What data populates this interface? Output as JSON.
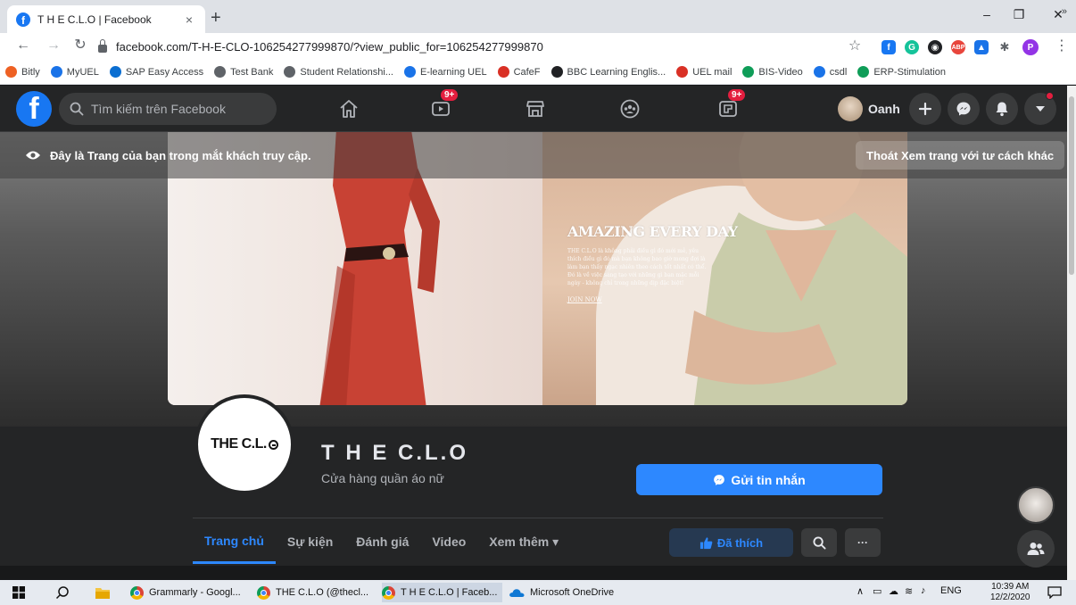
{
  "browser": {
    "tab_title": "T H E C.L.O | Facebook",
    "tab_close": "×",
    "new_tab": "+",
    "url": "facebook.com/T-H-E-CLO-106254277999870/?view_public_for=106254277999870",
    "bookmarks": [
      {
        "label": "Bitly",
        "color": "#ee6123"
      },
      {
        "label": "MyUEL",
        "color": "#1a73e8"
      },
      {
        "label": "SAP Easy Access",
        "color": "#0a6ed1"
      },
      {
        "label": "Test Bank",
        "color": "#5f6368"
      },
      {
        "label": "Student Relationshi...",
        "color": "#5f6368"
      },
      {
        "label": "E-learning UEL",
        "color": "#1a73e8"
      },
      {
        "label": "CafeF",
        "color": "#d93025"
      },
      {
        "label": "BBC Learning Englis...",
        "color": "#202124"
      },
      {
        "label": "UEL mail",
        "color": "#d93025"
      },
      {
        "label": "BIS-Video",
        "color": "#0f9d58"
      },
      {
        "label": "csdl",
        "color": "#1a73e8"
      },
      {
        "label": "ERP-Stimulation",
        "color": "#0f9d58"
      }
    ],
    "bookmarks_more": "»",
    "profile_letter": "P"
  },
  "fb": {
    "logo": "f",
    "search_placeholder": "Tìm kiếm trên Facebook",
    "watch_badge": "9+",
    "gaming_badge": "9+",
    "user_name": "Oanh"
  },
  "banner": {
    "text": "Đây là Trang của bạn trong mắt khách truy cập.",
    "exit_button": "Thoát Xem trang với tư cách khác"
  },
  "cover": {
    "headline": "AMAZING EVERY DAY",
    "paragraph": "THE C.L.O là không phải điều gì đó mới mẻ, yêu thích điều gì đó mà bạn không bao giờ mong đợi là làm bạn thấy ngạc nhiên theo cách tốt nhất có thể. Đó là về việc sáng tạo với những gì bạn mặc mỗi ngày - không chỉ trong những dịp đặc biệt!",
    "join": "JOIN NOW"
  },
  "page": {
    "avatar_text": "THE C.L.",
    "name": "T H E C.L.O",
    "category": "Cửa hàng quần áo nữ",
    "message_button": "Gửi tin nhắn",
    "tabs": [
      "Trang chủ",
      "Sự kiện",
      "Đánh giá",
      "Video",
      "Xem thêm ▾"
    ],
    "liked_button": "Đã thích",
    "more_button": "···"
  },
  "taskbar": {
    "items": [
      "Grammarly - Googl...",
      "THE C.L.O (@thecl...",
      "T H E C.L.O | Faceb...",
      "Microsoft OneDrive"
    ],
    "lang": "ENG",
    "time": "10:39 AM",
    "date": "12/2/2020"
  },
  "colors": {
    "fb_blue": "#1877f2",
    "fb_nav": "#242526",
    "accent_link": "#2d88ff",
    "badge_red": "#e41e3f"
  }
}
